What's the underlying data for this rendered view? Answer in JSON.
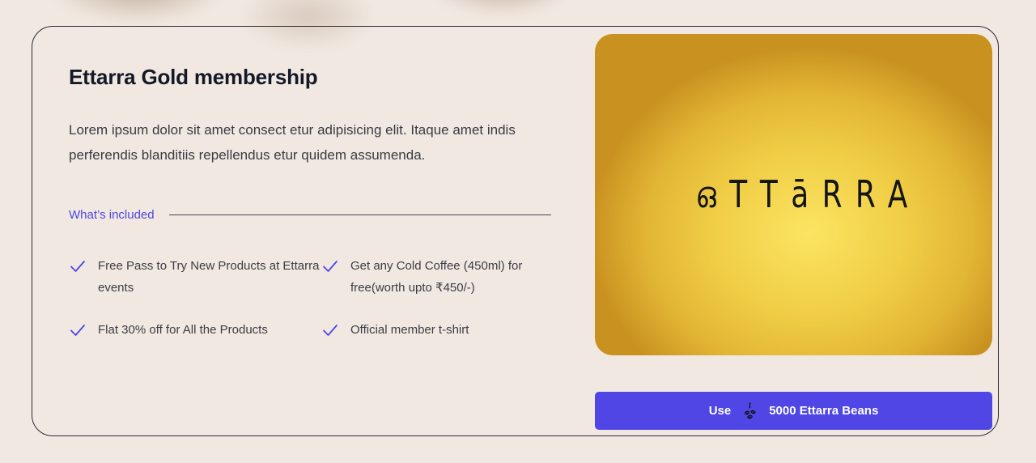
{
  "membership": {
    "title": "Ettarra Gold membership",
    "description": "Lorem ipsum dolor sit amet consect etur adipisicing elit. Itaque amet indis perferendis blanditiis repellendus etur quidem assumenda.",
    "included_label": "What’s included",
    "features": [
      "Free Pass to Try New Products at Ettarra events",
      "Get any Cold Coffee (450ml) for free(worth upto ₹450/-)",
      "Flat 30% off for All the Products",
      "Official member t-shirt"
    ]
  },
  "card_image": {
    "logo_text": "ഒTTāRRA",
    "background_color": "#f0cd45"
  },
  "cta": {
    "use_label": "Use",
    "beans_label": "5000 Ettarra Beans",
    "icon": "coffee-beans-icon",
    "color": "#4f46e5"
  },
  "colors": {
    "accent": "#4f46e5",
    "page_background": "#f1e8e1",
    "title": "#141827"
  }
}
